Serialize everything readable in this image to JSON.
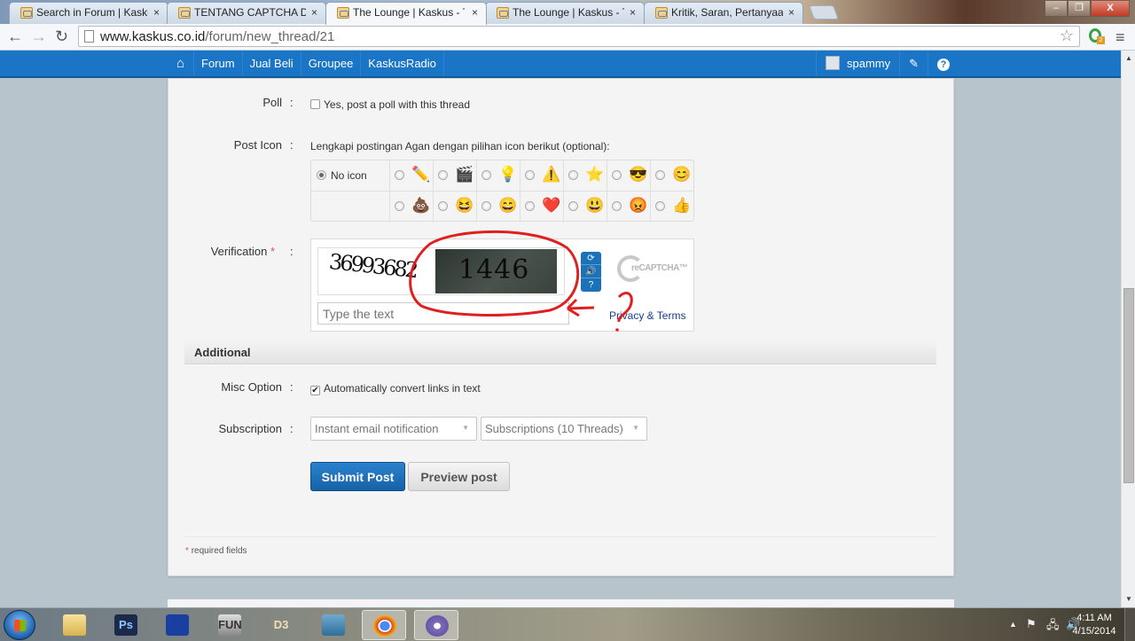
{
  "browser": {
    "tabs": [
      {
        "title": "Search in Forum | Kaskus",
        "active": false
      },
      {
        "title": "TENTANG CAPTCHA DAN",
        "active": false
      },
      {
        "title": "The Lounge | Kaskus - The",
        "active": true
      },
      {
        "title": "The Lounge | Kaskus - The",
        "active": false
      },
      {
        "title": "Kritik, Saran, Pertanyaan S",
        "active": false
      }
    ],
    "tab_close_glyph": "×",
    "url_host": "www.kaskus.co.id",
    "url_path": "/forum/new_thread/21",
    "back_glyph": "←",
    "forward_glyph": "→",
    "reload_glyph": "↻",
    "star_glyph": "☆",
    "menu_glyph": "≡",
    "extension_badge": "2",
    "window_buttons": {
      "minimize": "–",
      "maximize": "❐",
      "close": "X"
    }
  },
  "sitebar": {
    "home_glyph": "⌂",
    "nav": [
      "Forum",
      "Jual Beli",
      "Groupee",
      "KaskusRadio"
    ],
    "username": "spammy",
    "edit_glyph": "✎",
    "help_glyph": "?",
    "accent": "#1b75c6"
  },
  "form": {
    "poll": {
      "label": "Poll",
      "colon": ":",
      "checkbox_label": "Yes, post a poll with this thread",
      "checked": false
    },
    "post_icon": {
      "label": "Post Icon",
      "colon": ":",
      "hint": "Lengkapi postingan Agan dengan pilihan icon berikut (optional):",
      "no_icon_label": "No icon",
      "selected": "no-icon",
      "row1": [
        {
          "name": "pencil",
          "glyph": "✏️"
        },
        {
          "name": "clapperboard",
          "glyph": "🎬"
        },
        {
          "name": "lightbulb",
          "glyph": "💡"
        },
        {
          "name": "warning",
          "glyph": "⚠️"
        },
        {
          "name": "star",
          "glyph": "⭐"
        },
        {
          "name": "cool-face",
          "glyph": "😎"
        },
        {
          "name": "smile-face",
          "glyph": "😊"
        }
      ],
      "row2": [
        {
          "name": "poop",
          "glyph": "💩"
        },
        {
          "name": "laughing-face",
          "glyph": "😆"
        },
        {
          "name": "grinning-face",
          "glyph": "😄"
        },
        {
          "name": "heart",
          "glyph": "❤️"
        },
        {
          "name": "happy-blue-face",
          "glyph": "😃"
        },
        {
          "name": "angry-face",
          "glyph": "😡"
        },
        {
          "name": "thumbs-up",
          "glyph": "👍"
        }
      ]
    },
    "verification": {
      "label": "Verification",
      "required_mark": "*",
      "colon": ":",
      "captcha_word1": "36993682",
      "captcha_word2": "1446",
      "input_placeholder": "Type the text",
      "input_value": "",
      "btn_refresh": "⟳",
      "btn_audio": "🔊",
      "btn_help": "?",
      "logo_text": "reCAPTCHA™",
      "privacy_link": "Privacy & Terms"
    },
    "additional": {
      "section_title": "Additional",
      "misc_label": "Misc Option",
      "misc_colon": ":",
      "misc_checkbox_label": "Automatically convert links in text",
      "misc_checked": true,
      "check_glyph": "✔",
      "subscription_label": "Subscription",
      "subscription_colon": ":",
      "subscription_mode": "Instant email notification",
      "subscription_folder": "Subscriptions (10 Threads)",
      "caret_glyph": "▼"
    },
    "submit_label": "Submit Post",
    "preview_label": "Preview post",
    "required_note_mark": "*",
    "required_note": "required fields"
  },
  "annotation": {
    "question_mark": "?",
    "color": "#e02020"
  },
  "taskbar": {
    "apps": [
      {
        "name": "windows-explorer",
        "label": ""
      },
      {
        "name": "photoshop",
        "label": "Ps"
      },
      {
        "name": "app-blue-tower",
        "label": ""
      },
      {
        "name": "fun-drive",
        "label": "FUN"
      },
      {
        "name": "diablo3",
        "label": "D3"
      },
      {
        "name": "the-sims",
        "label": ""
      },
      {
        "name": "google-chrome",
        "label": ""
      },
      {
        "name": "bittorrent",
        "label": ""
      }
    ],
    "tray_show_hidden_glyph": "▲",
    "time": "4:11 AM",
    "date": "4/15/2014"
  }
}
